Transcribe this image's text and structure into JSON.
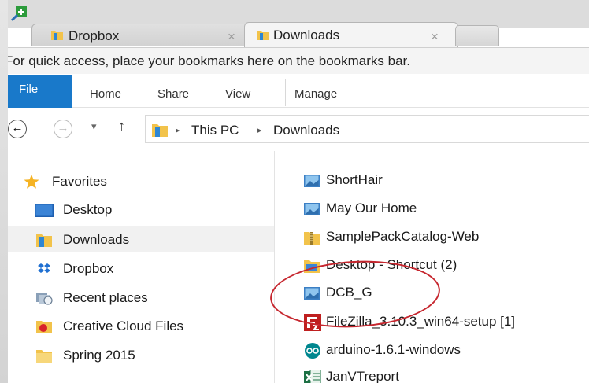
{
  "browser": {
    "tabs": [
      {
        "label": "Dropbox",
        "active": false
      },
      {
        "label": "Downloads",
        "active": true
      }
    ],
    "tab_close_glyph": "×",
    "bookmark_bar_text": "For quick access, place your bookmarks here on the bookmarks bar."
  },
  "ribbon": {
    "file_label": "File",
    "tabs": [
      "Home",
      "Share",
      "View",
      "Manage"
    ],
    "accent": "#1979ca"
  },
  "address": {
    "back_glyph": "←",
    "forward_glyph": "→",
    "recent_glyph": "▾",
    "up_glyph": "↑",
    "separator_glyph": "▸",
    "crumbs": [
      "This PC",
      "Downloads"
    ]
  },
  "nav_pane": {
    "items": [
      {
        "label": "Favorites",
        "icon": "star-icon"
      },
      {
        "label": "Desktop",
        "icon": "desktop-icon"
      },
      {
        "label": "Downloads",
        "icon": "downloads-folder-icon",
        "selected": true
      },
      {
        "label": "Dropbox",
        "icon": "dropbox-icon"
      },
      {
        "label": "Recent places",
        "icon": "recent-places-icon"
      },
      {
        "label": "Creative Cloud Files",
        "icon": "creative-cloud-icon"
      },
      {
        "label": "Spring 2015",
        "icon": "folder-icon"
      }
    ]
  },
  "files": {
    "items": [
      {
        "label": "ShortHair",
        "icon": "image-file-icon"
      },
      {
        "label": "May Our Home",
        "icon": "image-file-icon"
      },
      {
        "label": "SamplePackCatalog-Web",
        "icon": "zip-folder-icon"
      },
      {
        "label": "Desktop - Shortcut (2)",
        "icon": "shortcut-folder-icon"
      },
      {
        "label": "DCB_G",
        "icon": "image-file-icon",
        "highlighted": true
      },
      {
        "label": "FileZilla_3.10.3_win64-setup [1]",
        "icon": "filezilla-icon"
      },
      {
        "label": "arduino-1.6.1-windows",
        "icon": "arduino-icon"
      },
      {
        "label": "JanVTreport",
        "icon": "excel-icon"
      }
    ],
    "highlight_color": "#c6262e"
  }
}
